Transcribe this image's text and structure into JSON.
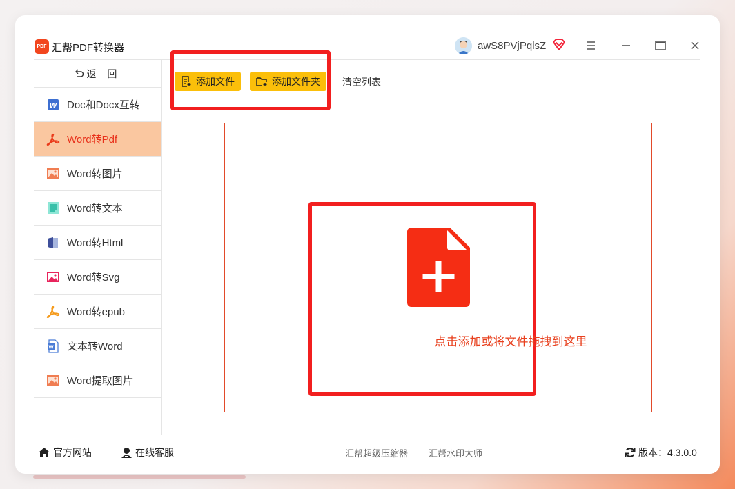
{
  "app": {
    "title": "汇帮PDF转换器",
    "logo_text": "PDF"
  },
  "user": {
    "name": "awS8PVjPqlsZ"
  },
  "colors": {
    "accent": "#fbbf0a",
    "active_bg": "#fac7a0",
    "active_text": "#e8301a",
    "highlight": "#f21f1f",
    "file_icon": "#f52d14"
  },
  "sidebar": {
    "back_label": "返 回",
    "items": [
      {
        "label": "Doc和Docx互转",
        "icon": "word-doc-icon",
        "active": false
      },
      {
        "label": "Word转Pdf",
        "icon": "pdf-icon",
        "active": true
      },
      {
        "label": "Word转图片",
        "icon": "image-icon",
        "active": false
      },
      {
        "label": "Word转文本",
        "icon": "text-doc-icon",
        "active": false
      },
      {
        "label": "Word转Html",
        "icon": "html-icon",
        "active": false
      },
      {
        "label": "Word转Svg",
        "icon": "svg-image-icon",
        "active": false
      },
      {
        "label": "Word转epub",
        "icon": "epub-icon",
        "active": false
      },
      {
        "label": "文本转Word",
        "icon": "word-file-icon",
        "active": false
      },
      {
        "label": "Word提取图片",
        "icon": "extract-image-icon",
        "active": false
      }
    ]
  },
  "toolbar": {
    "add_file": "添加文件",
    "add_folder": "添加文件夹",
    "clear_list": "清空列表"
  },
  "drop_zone": {
    "text": "点击添加或将文件拖拽到这里"
  },
  "footer": {
    "official_site": "官方网站",
    "online_service": "在线客服",
    "compressor": "汇帮超级压缩器",
    "watermark": "汇帮水印大师",
    "version": "版本：4.3.0.0"
  }
}
